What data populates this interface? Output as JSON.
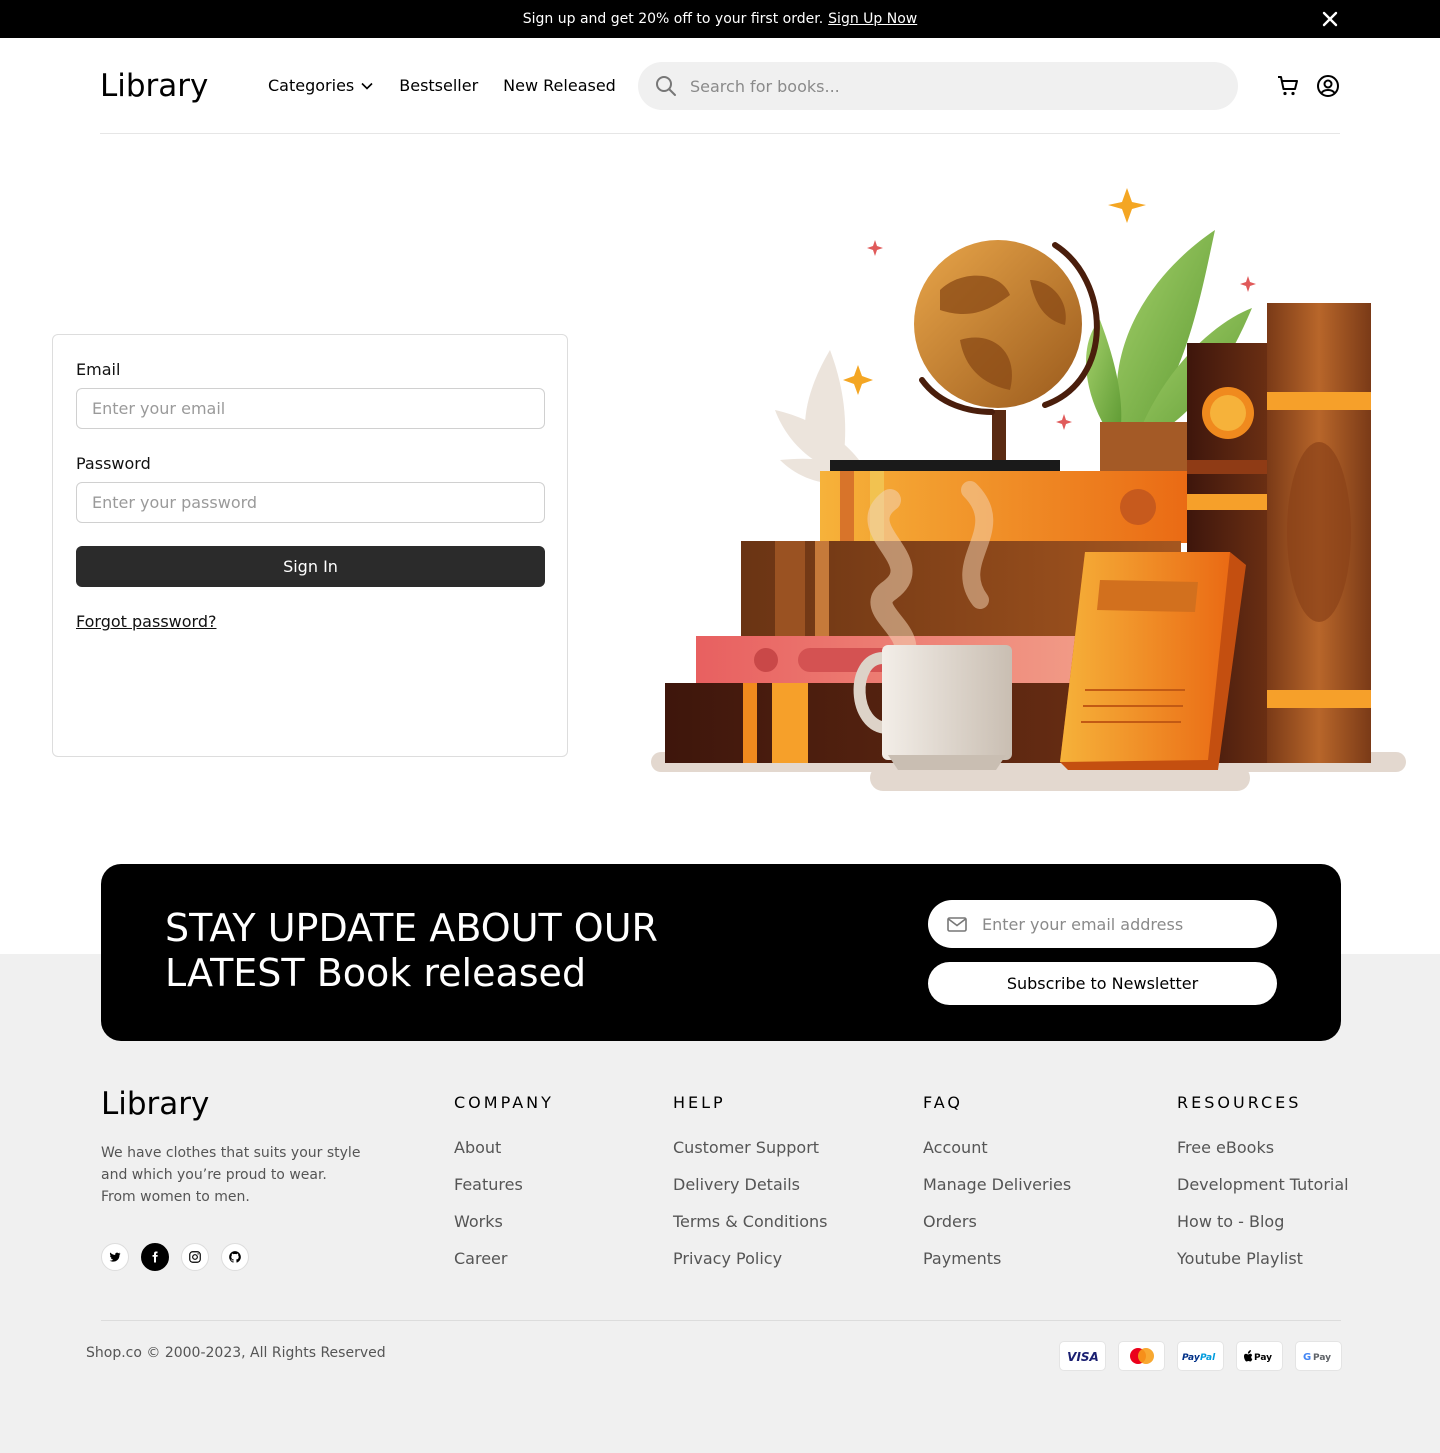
{
  "promo": {
    "text": "Sign up and get 20% off to your first order.",
    "link": "Sign Up Now"
  },
  "header": {
    "logo": "Library",
    "nav": [
      "Categories",
      "Bestseller",
      "New Released"
    ],
    "search_placeholder": "Search for books..."
  },
  "login": {
    "email_label": "Email",
    "email_placeholder": "Enter your email",
    "password_label": "Password",
    "password_placeholder": "Enter your password",
    "signin_label": "Sign In",
    "forgot_label": "Forgot password?"
  },
  "newsletter": {
    "title": "STAY UPDATE ABOUT OUR LATEST Book released",
    "input_placeholder": "Enter your email address",
    "button": "Subscribe to Newsletter"
  },
  "footer": {
    "logo": "Library",
    "description": "We have clothes that suits your style and which you’re proud to wear. From women to men.",
    "columns": [
      {
        "title": "COMPANY",
        "links": [
          "About",
          "Features",
          "Works",
          "Career"
        ]
      },
      {
        "title": "HELP",
        "links": [
          "Customer Support",
          "Delivery Details",
          "Terms & Conditions",
          "Privacy Policy"
        ]
      },
      {
        "title": "FAQ",
        "links": [
          "Account",
          "Manage Deliveries",
          "Orders",
          "Payments"
        ]
      },
      {
        "title": "RESOURCES",
        "links": [
          "Free eBooks",
          "Development Tutorial",
          "How to - Blog",
          "Youtube Playlist"
        ]
      }
    ],
    "copyright": "Shop.co © 2000-2023, All Rights Reserved",
    "payments": [
      "VISA",
      "Mastercard",
      "PayPal",
      "Apple Pay",
      "G Pay"
    ],
    "socials": [
      "twitter-icon",
      "facebook-icon",
      "instagram-icon",
      "github-icon"
    ]
  },
  "colors": {
    "promo_bg": "#000000",
    "button_dark": "#2b2b2b",
    "footer_bg": "#f0f0f0",
    "newsletter_bg": "#000000"
  }
}
